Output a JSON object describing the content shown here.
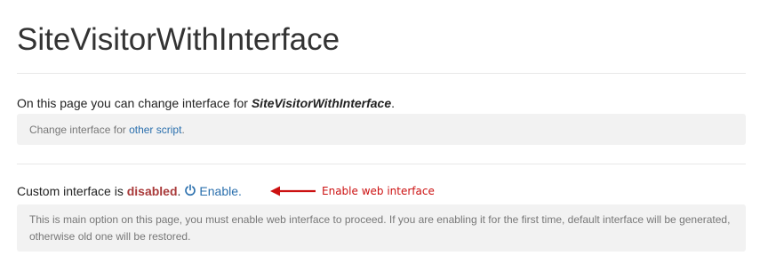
{
  "page": {
    "title": "SiteVisitorWithInterface"
  },
  "intro": {
    "prefix": "On this page you can change interface for ",
    "script_name": "SiteVisitorWithInterface",
    "suffix": "."
  },
  "change_note": {
    "prefix": "Change interface for ",
    "link_label": "other script",
    "suffix": "."
  },
  "custom_interface": {
    "prefix": "Custom interface is ",
    "state": "disabled",
    "after_state": ".",
    "enable_label": "Enable.",
    "enable_icon": "power-icon"
  },
  "annotation": {
    "text": "Enable web interface",
    "color": "#cc1111"
  },
  "help_note": {
    "text": "This is main option on this page, you must enable web interface to proceed. If you are enabling it for the first time, default interface will be generated, otherwise old one will be restored."
  },
  "colors": {
    "link": "#2a6fad",
    "disabled_state": "#a93a3a",
    "well_background": "#f2f2f2"
  }
}
